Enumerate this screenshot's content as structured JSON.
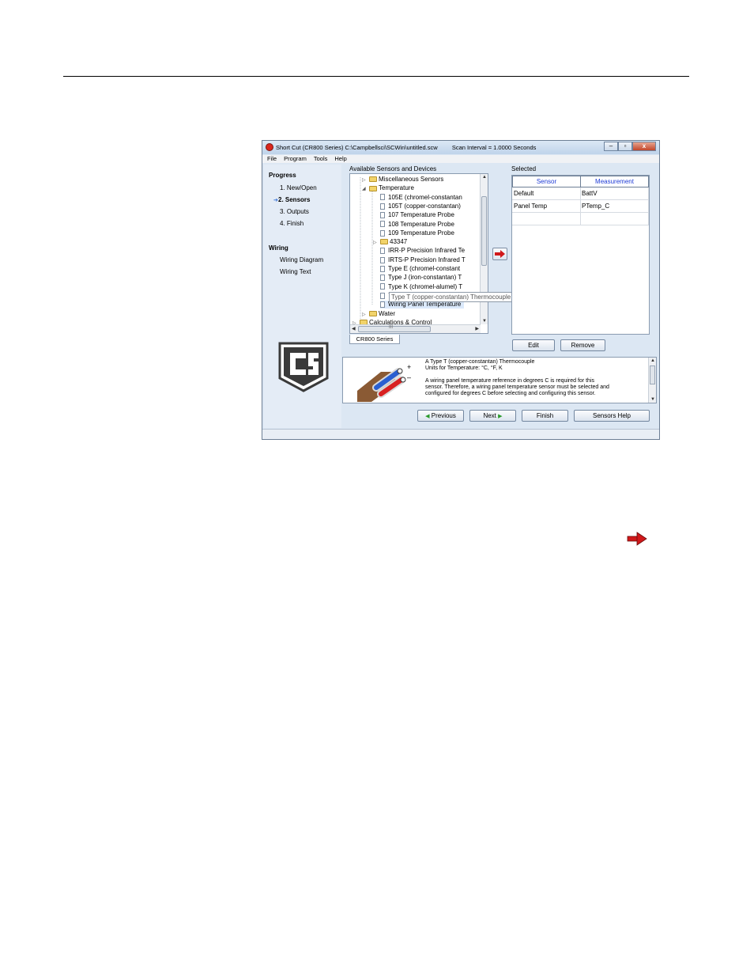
{
  "window": {
    "title": "Short Cut (CR800 Series) C:\\Campbellsci\\SCWin\\untitled.scw",
    "scan_interval": "Scan Interval = 1.0000 Seconds",
    "controls": {
      "minimize": "–",
      "maximize": "▫",
      "close": "x"
    }
  },
  "menu": [
    "File",
    "Program",
    "Tools",
    "Help"
  ],
  "progress": {
    "heading": "Progress",
    "steps": [
      "1. New/Open",
      "2. Sensors",
      "3. Outputs",
      "4. Finish"
    ],
    "current_marker": "➔"
  },
  "wiring": {
    "heading": "Wiring",
    "items": [
      "Wiring Diagram",
      "Wiring Text"
    ]
  },
  "available": {
    "label": "Available Sensors and Devices",
    "tree": [
      {
        "text": "Miscellaneous Sensors",
        "kind": "folder",
        "expander": "▷"
      },
      {
        "text": "Temperature",
        "kind": "folder",
        "expander": "◢"
      },
      {
        "text": "105E (chromel-constantan",
        "kind": "item"
      },
      {
        "text": "105T (copper-constantan)",
        "kind": "item"
      },
      {
        "text": "107 Temperature Probe",
        "kind": "item"
      },
      {
        "text": "108 Temperature Probe",
        "kind": "item"
      },
      {
        "text": "109 Temperature Probe",
        "kind": "item"
      },
      {
        "text": "43347",
        "kind": "folder",
        "expander": "▷"
      },
      {
        "text": "IRR-P Precision Infrared Te",
        "kind": "item"
      },
      {
        "text": "IRTS-P Precision Infrared T",
        "kind": "item"
      },
      {
        "text": "Type E (chromel-constant",
        "kind": "item"
      },
      {
        "text": "Type J (iron-constantan) T",
        "kind": "item"
      },
      {
        "text": "Type K (chromel-alumel) T",
        "kind": "item"
      },
      {
        "text": "Type T (copper-constantan) Thermocouple",
        "kind": "item"
      },
      {
        "text": "Wiring Panel Temperature",
        "kind": "item"
      },
      {
        "text": "Water",
        "kind": "folder",
        "expander": "▷"
      },
      {
        "text": "Calculations & Control",
        "kind": "folder",
        "expander": "▷"
      }
    ],
    "tooltip": "Type T (copper-constantan) Thermocouple",
    "tab": "CR800 Series",
    "hscroll_grip": "III"
  },
  "selected": {
    "label": "Selected",
    "columns": [
      "Sensor",
      "Measurement"
    ],
    "rows": [
      {
        "sensor": "Default",
        "measurement": "BattV"
      },
      {
        "sensor": "Panel Temp",
        "measurement": "PTemp_C"
      }
    ]
  },
  "buttons": {
    "edit": "Edit",
    "remove": "Remove",
    "previous": "Previous",
    "next": "Next",
    "finish": "Finish",
    "help": "Sensors Help",
    "prev_arrow": "◀",
    "next_arrow": "▶"
  },
  "description": {
    "lines": [
      "A Type T (copper-constantan) Thermocouple",
      "Units for Temperature: °C, °F, K",
      "",
      "A wiring panel temperature reference in degrees C is required for this",
      "sensor. Therefore, a wiring panel temperature sensor must be selected and",
      "configured for degrees C before selecting and configuring this sensor."
    ],
    "plus": "+",
    "minus": "–"
  },
  "colors": {
    "arrow_red": "#d0181a",
    "header_blue": "#1f3bd6",
    "window_bg": "#dce7f3"
  }
}
